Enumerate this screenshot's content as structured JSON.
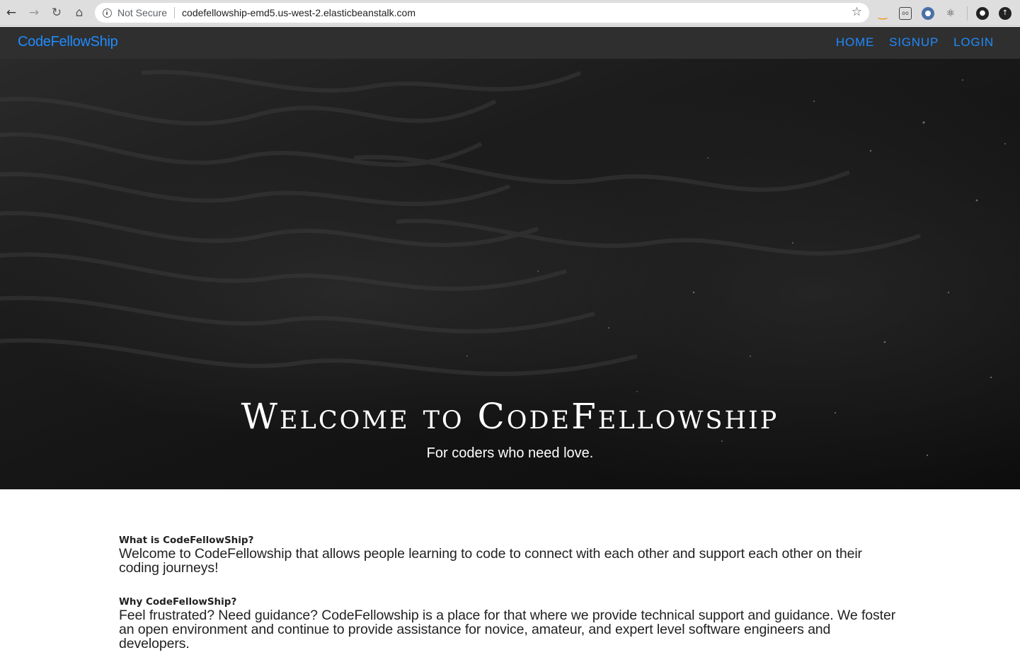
{
  "browser": {
    "back_icon": "arrow-left-icon",
    "forward_icon": "arrow-right-icon",
    "reload_icon": "reload-icon",
    "home_icon": "home-icon",
    "security_label": "Not Secure",
    "url": "codefellowship-emd5.us-west-2.elasticbeanstalk.com",
    "bookmark_icon": "star-icon",
    "extensions": [
      "amazon-icon",
      "goggles-icon",
      "circle-extension-icon",
      "react-devtools-icon",
      "profile-icon",
      "update-icon"
    ]
  },
  "nav": {
    "brand": "CodeFellowShip",
    "links": [
      "HOME",
      "SIGNUP",
      "LOGIN"
    ],
    "accent_color": "#1f8bff",
    "background": "#2f2f2f"
  },
  "hero": {
    "title": "Welcome to CodeFellowship",
    "subtitle": "For coders who need love."
  },
  "sections": [
    {
      "heading": "What is CodeFellowShip?",
      "body": "Welcome to CodeFellowship that allows people learning to code to connect with each other and support each other on their coding journeys!"
    },
    {
      "heading": "Why CodeFellowShip?",
      "body": "Feel frustrated? Need guidance? CodeFellowship is a place for that where we provide technical support and guidance. We foster an open environment and continue to provide assistance for novice, amateur, and expert level software engineers and developers."
    }
  ]
}
